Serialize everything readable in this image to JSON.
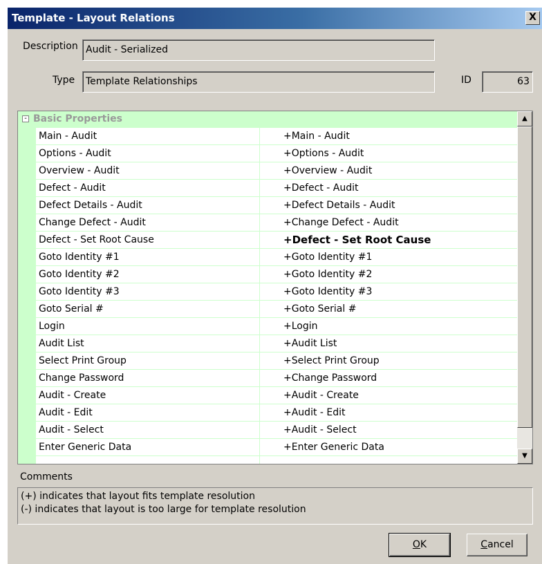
{
  "window": {
    "title": "Template - Layout Relations",
    "close_label": "X"
  },
  "description": {
    "label": "Description",
    "value": "Audit - Serialized"
  },
  "type": {
    "label": "Type",
    "value": "Template Relationships"
  },
  "id": {
    "label": "ID",
    "value": "63"
  },
  "grid": {
    "category": "Basic Properties",
    "collapse_glyph": "-",
    "rows": [
      {
        "name": "Main - Audit",
        "value": "+Main - Audit"
      },
      {
        "name": "Options - Audit",
        "value": "+Options - Audit"
      },
      {
        "name": "Overview - Audit",
        "value": "+Overview - Audit"
      },
      {
        "name": "Defect - Audit",
        "value": "+Defect - Audit"
      },
      {
        "name": "Defect Details - Audit",
        "value": "+Defect Details - Audit"
      },
      {
        "name": "Change Defect - Audit",
        "value": "+Change Defect - Audit"
      },
      {
        "name": "Defect - Set Root Cause",
        "value": "+Defect - Set Root Cause"
      },
      {
        "name": "Goto Identity #1",
        "value": "+Goto Identity #1"
      },
      {
        "name": "Goto Identity #2",
        "value": "+Goto Identity #2"
      },
      {
        "name": "Goto Identity #3",
        "value": "+Goto Identity #3"
      },
      {
        "name": "Goto Serial #",
        "value": "+Goto Serial #"
      },
      {
        "name": "Login",
        "value": "+Login"
      },
      {
        "name": "Audit List",
        "value": "+Audit List"
      },
      {
        "name": "Select Print Group",
        "value": "+Select Print Group"
      },
      {
        "name": "Change Password",
        "value": "+Change Password"
      },
      {
        "name": "Audit - Create",
        "value": "+Audit - Create"
      },
      {
        "name": "Audit - Edit",
        "value": "+Audit - Edit"
      },
      {
        "name": "Audit - Select",
        "value": "+Audit - Select"
      },
      {
        "name": "Enter Generic Data",
        "value": "+Enter Generic Data"
      }
    ],
    "scroll_up_glyph": "▲",
    "scroll_down_glyph": "▼"
  },
  "comments": {
    "label": "Comments",
    "line1": "(+) indicates that layout fits template resolution",
    "line2": "(-) indicates that layout is too large for template resolution"
  },
  "buttons": {
    "ok_mnemonic": "O",
    "ok_rest": "K",
    "cancel_mnemonic": "C",
    "cancel_rest": "ancel"
  },
  "colors": {
    "title_start": "#0a246a",
    "title_end": "#a6caf0",
    "grid_accent": "#ccffcc",
    "dialog_bg": "#d4d0c8"
  }
}
